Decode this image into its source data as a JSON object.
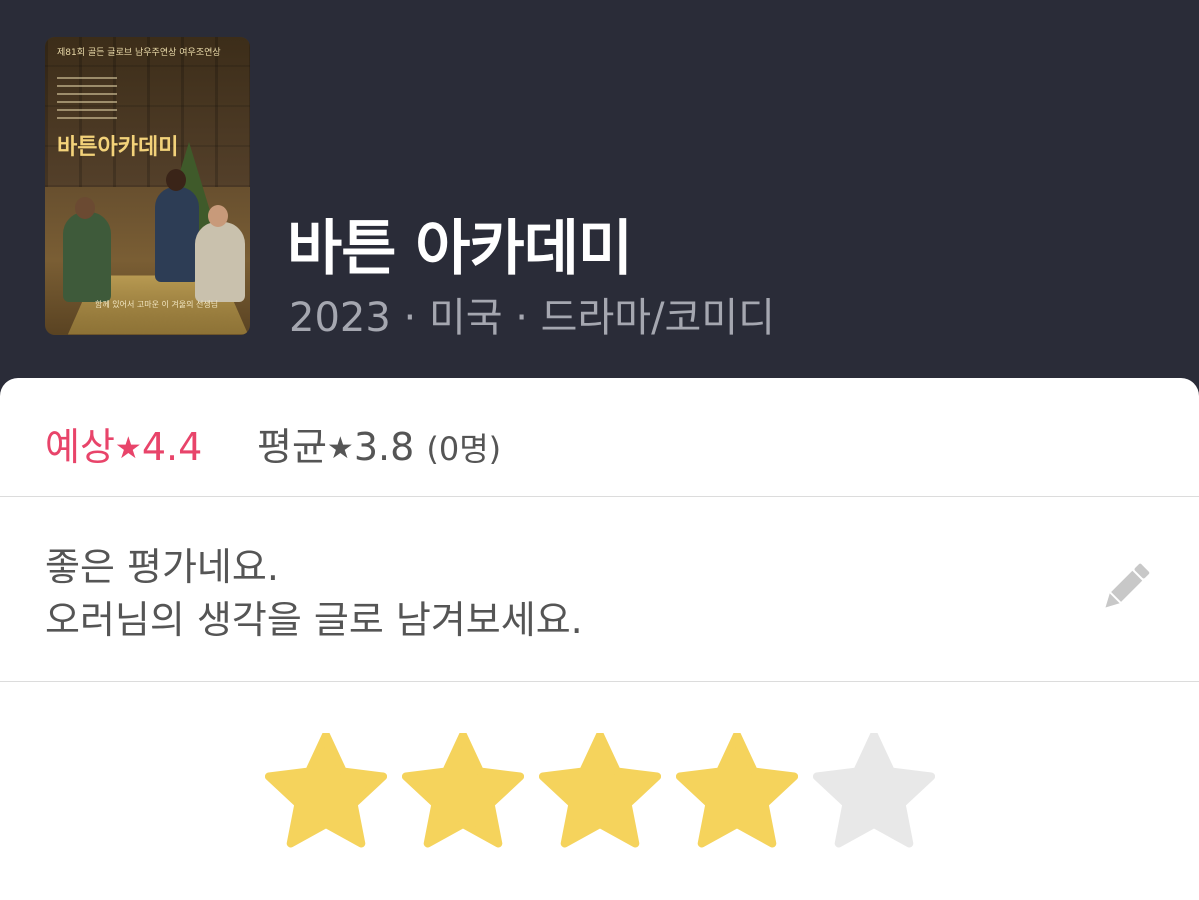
{
  "header": {
    "title": "바튼 아카데미",
    "meta": "2023 · 미국 · 드라마/코미디",
    "poster": {
      "top_line": "제81회 골든 글로브 남우주연상 여우조연상",
      "title": "바튼아카데미",
      "tagline": "함께 있어서 고마운 이 겨울의 선생님"
    }
  },
  "rating": {
    "expected_label": "예상",
    "expected_value": "4.4",
    "average_label": "평균",
    "average_value": "3.8",
    "average_count": "(0명)",
    "star_glyph": "★",
    "expected_color": "#e8446a"
  },
  "comment": {
    "line1": "좋은 평가네요.",
    "line2": "오러님의 생각을 글로 남겨보세요.",
    "icon": "pencil-icon"
  },
  "user_rating": {
    "value": 4,
    "max": 5,
    "filled_color": "#f5d35c",
    "empty_color": "#e8e8e8"
  }
}
